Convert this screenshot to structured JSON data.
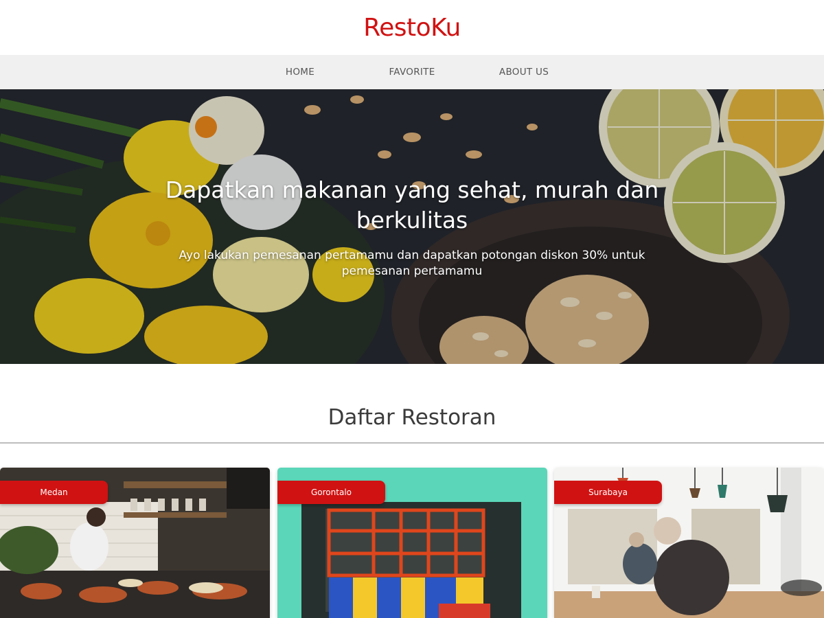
{
  "brand": {
    "name": "RestoKu",
    "color": "#d01212"
  },
  "nav": {
    "items": [
      {
        "label": "HOME"
      },
      {
        "label": "FAVORITE"
      },
      {
        "label": "ABOUT US"
      }
    ]
  },
  "hero": {
    "title": "Dapatkan makanan yang sehat, murah dan berkulitas",
    "subtitle": "Ayo lakukan pemesanan pertamamu dan dapatkan potongan diskon 30% untuk pemesanan pertamamu"
  },
  "section": {
    "title": "Daftar Restoran"
  },
  "restaurants": [
    {
      "city": "Medan"
    },
    {
      "city": "Gorontalo"
    },
    {
      "city": "Surabaya"
    }
  ]
}
